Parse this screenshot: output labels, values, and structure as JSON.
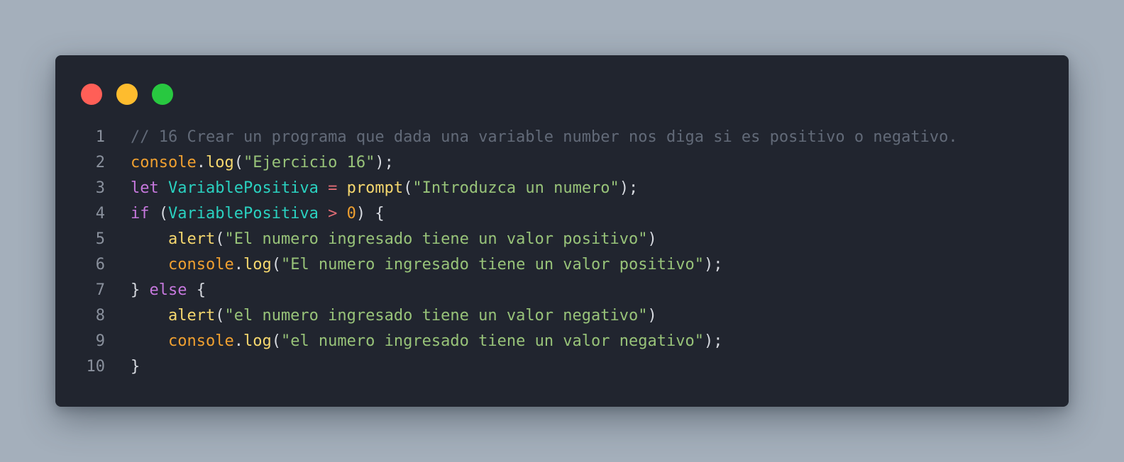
{
  "window": {
    "controls": [
      "close",
      "minimize",
      "maximize"
    ],
    "background": "#21252f"
  },
  "code": {
    "language": "javascript",
    "lines": [
      {
        "num": "1",
        "tokens": [
          {
            "t": "// 16 Crear un programa que dada una variable number nos diga si es positivo o negativo.",
            "c": "comment"
          }
        ]
      },
      {
        "num": "2",
        "tokens": [
          {
            "t": "console",
            "c": "obj"
          },
          {
            "t": ".",
            "c": "punc"
          },
          {
            "t": "log",
            "c": "fn"
          },
          {
            "t": "(",
            "c": "punc"
          },
          {
            "t": "\"Ejercicio 16\"",
            "c": "str"
          },
          {
            "t": ");",
            "c": "punc"
          }
        ]
      },
      {
        "num": "3",
        "tokens": [
          {
            "t": "let",
            "c": "kw"
          },
          {
            "t": " ",
            "c": "punc"
          },
          {
            "t": "VariablePositiva",
            "c": "var"
          },
          {
            "t": " ",
            "c": "punc"
          },
          {
            "t": "=",
            "c": "op"
          },
          {
            "t": " ",
            "c": "punc"
          },
          {
            "t": "prompt",
            "c": "fn"
          },
          {
            "t": "(",
            "c": "punc"
          },
          {
            "t": "\"Introduzca un numero\"",
            "c": "str"
          },
          {
            "t": ");",
            "c": "punc"
          }
        ]
      },
      {
        "num": "4",
        "tokens": [
          {
            "t": "if",
            "c": "kw"
          },
          {
            "t": " (",
            "c": "punc"
          },
          {
            "t": "VariablePositiva",
            "c": "var"
          },
          {
            "t": " ",
            "c": "punc"
          },
          {
            "t": ">",
            "c": "op"
          },
          {
            "t": " ",
            "c": "punc"
          },
          {
            "t": "0",
            "c": "num"
          },
          {
            "t": ") {",
            "c": "punc"
          }
        ]
      },
      {
        "num": "5",
        "tokens": [
          {
            "t": "    ",
            "c": "punc"
          },
          {
            "t": "alert",
            "c": "fn"
          },
          {
            "t": "(",
            "c": "punc"
          },
          {
            "t": "\"El numero ingresado tiene un valor positivo\"",
            "c": "str"
          },
          {
            "t": ")",
            "c": "punc"
          }
        ]
      },
      {
        "num": "6",
        "tokens": [
          {
            "t": "    ",
            "c": "punc"
          },
          {
            "t": "console",
            "c": "obj"
          },
          {
            "t": ".",
            "c": "punc"
          },
          {
            "t": "log",
            "c": "fn"
          },
          {
            "t": "(",
            "c": "punc"
          },
          {
            "t": "\"El numero ingresado tiene un valor positivo\"",
            "c": "str"
          },
          {
            "t": ");",
            "c": "punc"
          }
        ]
      },
      {
        "num": "7",
        "tokens": [
          {
            "t": "} ",
            "c": "punc"
          },
          {
            "t": "else",
            "c": "kw"
          },
          {
            "t": " {",
            "c": "punc"
          }
        ]
      },
      {
        "num": "8",
        "tokens": [
          {
            "t": "    ",
            "c": "punc"
          },
          {
            "t": "alert",
            "c": "fn"
          },
          {
            "t": "(",
            "c": "punc"
          },
          {
            "t": "\"el numero ingresado tiene un valor negativo\"",
            "c": "str"
          },
          {
            "t": ")",
            "c": "punc"
          }
        ]
      },
      {
        "num": "9",
        "tokens": [
          {
            "t": "    ",
            "c": "punc"
          },
          {
            "t": "console",
            "c": "obj"
          },
          {
            "t": ".",
            "c": "punc"
          },
          {
            "t": "log",
            "c": "fn"
          },
          {
            "t": "(",
            "c": "punc"
          },
          {
            "t": "\"el numero ingresado tiene un valor negativo\"",
            "c": "str"
          },
          {
            "t": ");",
            "c": "punc"
          }
        ]
      },
      {
        "num": "10",
        "tokens": [
          {
            "t": "}",
            "c": "punc"
          }
        ]
      }
    ]
  }
}
